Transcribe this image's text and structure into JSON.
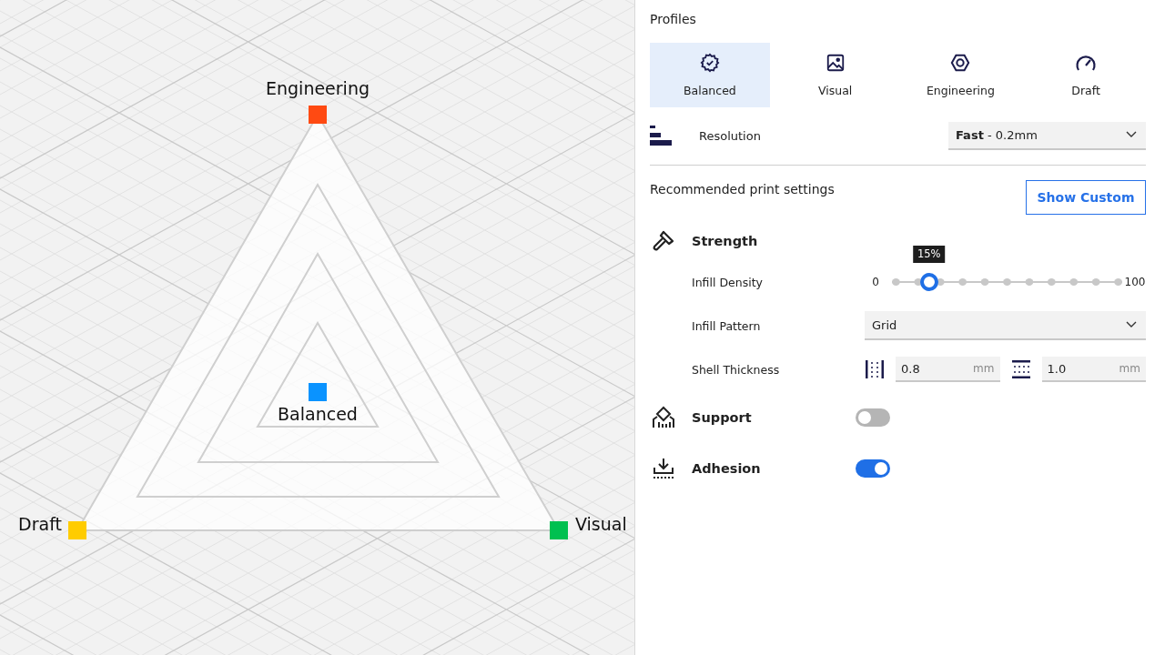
{
  "diagram": {
    "points": [
      {
        "label": "Engineering",
        "color": "#ff4a12"
      },
      {
        "label": "Balanced",
        "color": "#0a93ff"
      },
      {
        "label": "Draft",
        "color": "#ffcc00"
      },
      {
        "label": "Visual",
        "color": "#00c050"
      }
    ]
  },
  "panel": {
    "title": "Profiles",
    "tabs": [
      {
        "label": "Balanced",
        "selected": true
      },
      {
        "label": "Visual",
        "selected": false
      },
      {
        "label": "Engineering",
        "selected": false
      },
      {
        "label": "Draft",
        "selected": false
      }
    ],
    "resolution": {
      "label": "Resolution",
      "value": "**Fast** - 0.2mm"
    },
    "recommended": {
      "title": "Recommended print settings",
      "button": "Show Custom"
    },
    "strength": {
      "title": "Strength",
      "infill_density": {
        "label": "Infill Density",
        "min": "0",
        "max": "100",
        "tooltip": "15%",
        "level": 0.15
      },
      "infill_pattern": {
        "label": "Infill Pattern",
        "value": "Grid"
      },
      "shell_thickness": {
        "label": "Shell Thickness",
        "wall": {
          "value": "0.8",
          "unit": "mm"
        },
        "top_bottom": {
          "value": "1.0",
          "unit": "mm"
        }
      }
    },
    "support": {
      "title": "Support",
      "on": false
    },
    "adhesion": {
      "title": "Adhesion",
      "on": true
    }
  }
}
